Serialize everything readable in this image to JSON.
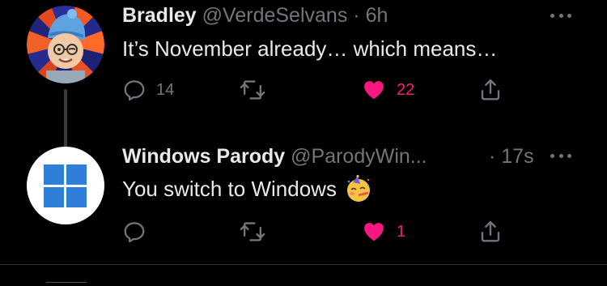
{
  "tweets": [
    {
      "author_name": "Bradley",
      "handle": "@VerdeSelvans",
      "separator": "·",
      "time": "6h",
      "text": "It’s November already… which means…",
      "avatar_icon": "memoji-avatar",
      "replies": "14",
      "retweets": "",
      "likes": "22",
      "liked": true
    },
    {
      "author_name": "Windows Parody",
      "handle": "@ParodyWin...",
      "separator": "·",
      "time": "17s",
      "text": "You switch to Windows",
      "emoji": "partying-face-emoji",
      "avatar_icon": "windows-logo",
      "replies": "",
      "retweets": "",
      "likes": "1",
      "liked": true
    }
  ],
  "colors": {
    "background": "#000000",
    "text_primary": "#e7e9ea",
    "text_secondary": "#71767b",
    "like": "#f91880",
    "windows_blue": "#2f7fd8",
    "divider": "#2f3336"
  }
}
